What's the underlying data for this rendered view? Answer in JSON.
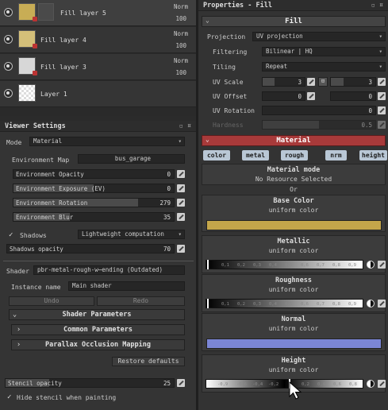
{
  "layers": [
    {
      "name": "Fill layer 5",
      "blend": "Norm",
      "opacity": "100",
      "thumb": "#c8ad55",
      "selected": true
    },
    {
      "name": "Fill layer 4",
      "blend": "Norm",
      "opacity": "100",
      "thumb": "#d4bf79",
      "selected": false
    },
    {
      "name": "Fill layer 3",
      "blend": "Norm",
      "opacity": "100",
      "thumb": "#d7d7d7",
      "selected": false
    },
    {
      "name": "Layer 1",
      "blend": "Norm",
      "opacity": "100",
      "thumb": "checker",
      "selected": false
    }
  ],
  "viewer": {
    "title": "Viewer Settings",
    "mode_label": "Mode",
    "mode_value": "Material",
    "env_map_label": "Environment Map",
    "env_map_value": "bus_garage",
    "sliders": [
      {
        "label": "Environment Opacity",
        "value": "0",
        "fraction": 0
      },
      {
        "label": "Environment Exposure (EV)",
        "value": "0",
        "fraction": 0.5
      },
      {
        "label": "Environment Rotation",
        "value": "279",
        "fraction": 0.775
      },
      {
        "label": "Environment Blur",
        "value": "35",
        "fraction": 0.35
      }
    ],
    "shadows_label": "Shadows",
    "shadows_mode": "Lightweight computation",
    "shadows_opacity_label": "Shadows opacity",
    "shadows_opacity_value": "70",
    "shader_label": "Shader",
    "shader_value": "pbr-metal-rough-w⋯ending (Outdated)",
    "instance_label": "Instance name",
    "instance_value": "Main shader",
    "undo": "Undo",
    "redo": "Redo",
    "shader_params": "Shader Parameters",
    "common_params": "Common Parameters",
    "parallax": "Parallax Occlusion Mapping",
    "restore": "Restore defaults",
    "stencil_label": "Stencil opacity",
    "stencil_value": "25",
    "hide_stencil": "Hide stencil when painting"
  },
  "props": {
    "title": "Properties - Fill",
    "fill_header": "Fill",
    "projection_label": "Projection",
    "projection_value": "UV projection",
    "filtering_label": "Filtering",
    "filtering_value": "Bilinear | HQ",
    "tiling_label": "Tiling",
    "tiling_value": "Repeat",
    "uv_scale_label": "UV Scale",
    "uv_scale_a": "3",
    "uv_scale_b": "3",
    "uv_offset_label": "UV Offset",
    "uv_offset_a": "0",
    "uv_offset_b": "0",
    "uv_rotation_label": "UV Rotation",
    "uv_rotation_value": "0",
    "hardness_label": "Hardness",
    "hardness_value": "0.5",
    "material_header": "Material",
    "chips": [
      "color",
      "metal",
      "rough",
      "nrm",
      "height"
    ],
    "material_mode": "Material mode",
    "no_resource": "No Resource Selected",
    "or": "Or",
    "channels": [
      {
        "title": "Base Color",
        "sub": "uniform color",
        "swatch": "#c4a64a"
      },
      {
        "title": "Metallic",
        "sub": "uniform color"
      },
      {
        "title": "Roughness",
        "sub": "uniform color"
      },
      {
        "title": "Normal",
        "sub": "uniform color",
        "swatch": "#7b86d6"
      },
      {
        "title": "Height",
        "sub": "uniform color"
      }
    ],
    "ticks_pos": [
      "0,1",
      "0,2",
      "0,3",
      "0,4",
      "0,5",
      "0,6",
      "0,7",
      "0,8",
      "0,9"
    ],
    "ticks_height": [
      "-0,9",
      "-0,6",
      "-0,4",
      "-0,2",
      "0,2",
      "0,4",
      "0,6",
      "0,8"
    ]
  },
  "colors": {
    "accent_red": "#a83a3a",
    "chip": "#b9c7d5"
  }
}
